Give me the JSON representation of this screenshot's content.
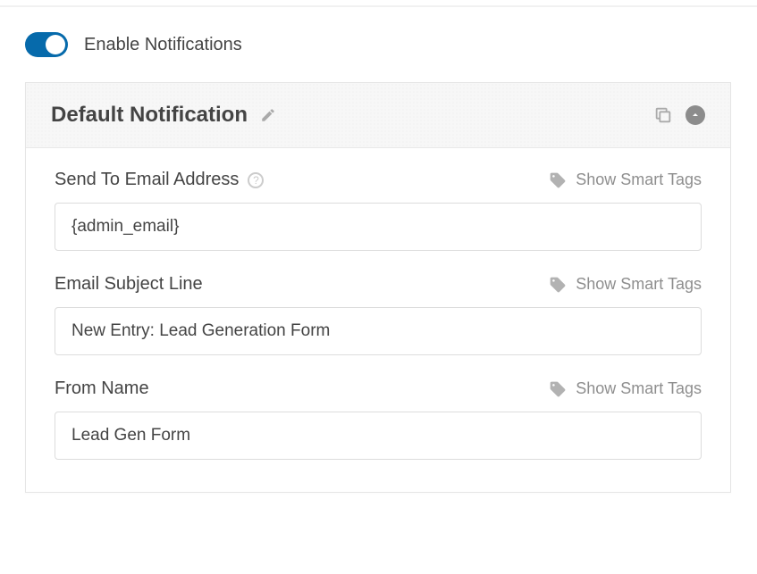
{
  "toggle": {
    "enabled": true,
    "label": "Enable Notifications"
  },
  "panel": {
    "title": "Default Notification"
  },
  "fields": {
    "send_to": {
      "label": "Send To Email Address",
      "smart_tags_label": "Show Smart Tags",
      "value": "{admin_email}"
    },
    "subject": {
      "label": "Email Subject Line",
      "smart_tags_label": "Show Smart Tags",
      "value": "New Entry: Lead Generation Form"
    },
    "from_name": {
      "label": "From Name",
      "smart_tags_label": "Show Smart Tags",
      "value": "Lead Gen Form"
    }
  }
}
